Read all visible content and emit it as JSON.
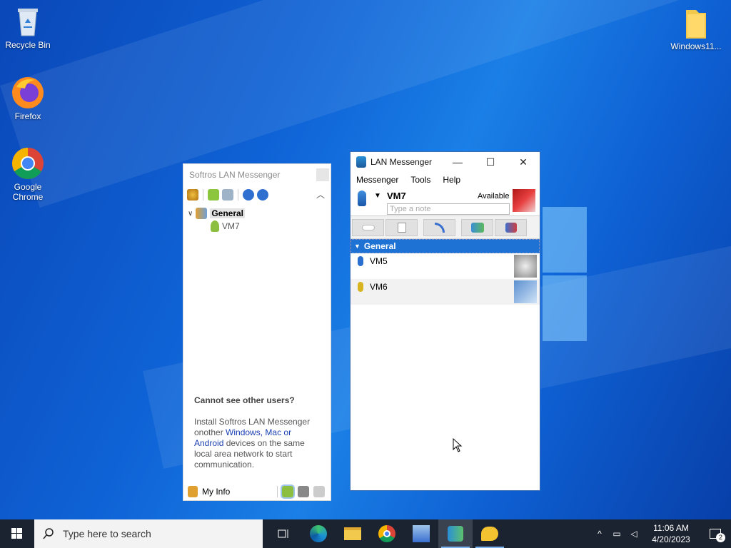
{
  "desktop": {
    "icons": [
      {
        "label": "Recycle Bin",
        "icon": "recycle-bin-icon"
      },
      {
        "label": "Firefox",
        "icon": "firefox-icon"
      },
      {
        "label": "Google Chrome",
        "icon": "chrome-icon"
      },
      {
        "label": "Windows11...",
        "icon": "folder-icon"
      }
    ]
  },
  "softros": {
    "title": "Softros LAN Messenger",
    "tree": {
      "group": "General",
      "user": "VM7"
    },
    "help": {
      "heading": "Cannot see other users?",
      "text_before": "Install Softros LAN Messenger onother ",
      "link1": "Windows",
      "sep1": ", ",
      "link2": "Mac",
      "sep2": " or ",
      "link3": "Android",
      "text_after": " devices on the same local area network to start communication."
    },
    "bottom": {
      "my_info": "My Info"
    }
  },
  "lan": {
    "title": "LAN Messenger",
    "menu": [
      "Messenger",
      "Tools",
      "Help"
    ],
    "me": {
      "name": "VM7",
      "status": "Available",
      "note_placeholder": "Type a note"
    },
    "group": "General",
    "contacts": [
      {
        "name": "VM5",
        "status_color": "#2a6fd0"
      },
      {
        "name": "VM6",
        "status_color": "#d8b420"
      }
    ]
  },
  "taskbar": {
    "search_placeholder": "Type here to search",
    "time": "11:06 AM",
    "date": "4/20/2023",
    "notification_count": "2"
  }
}
